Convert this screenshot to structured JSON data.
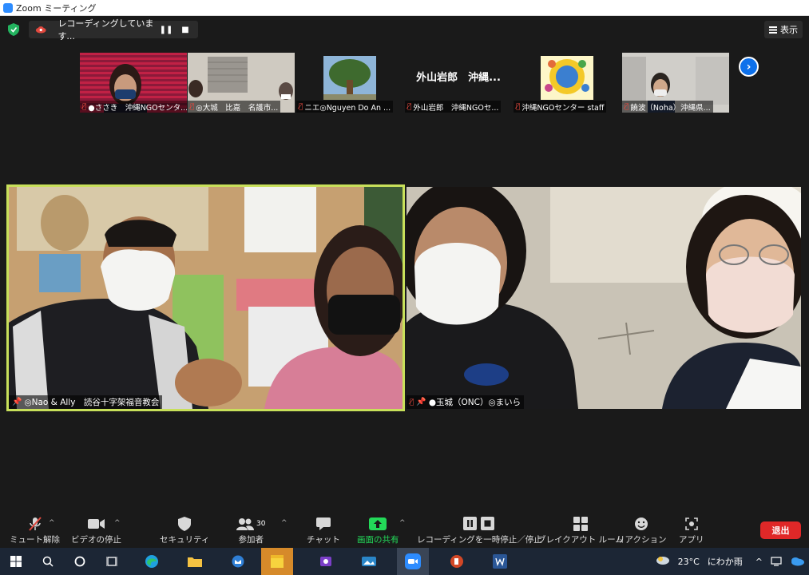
{
  "window": {
    "title": "Zoom ミーティング"
  },
  "recording": {
    "text": "レコーディングしています..."
  },
  "view_button": {
    "label": "表示"
  },
  "thumbnails": [
    {
      "name": "●ささき　沖縄NGOセンタ..."
    },
    {
      "name": "◎大城　比嘉　名護市..."
    },
    {
      "name": "ニエ◎Nguyen Do An ..."
    },
    {
      "name": "外山岩郎　沖縄NGOセ...",
      "display_text": "外山岩郎　沖縄..."
    },
    {
      "name": "沖縄NGOセンター staff"
    },
    {
      "name": "饒波（Noha）沖縄県..."
    }
  ],
  "main_tiles": [
    {
      "name": "◎Nao & Ally　読谷十字架福音教会"
    },
    {
      "name": "●玉城（ONC）◎まいら"
    }
  ],
  "toolbar": {
    "mute": "ミュート解除",
    "video": "ビデオの停止",
    "security": "セキュリティ",
    "participants": "参加者",
    "participants_count": "30",
    "chat": "チャット",
    "share": "画面の共有",
    "record": "レコーディングを一時停止／停止",
    "breakout": "ブレイクアウト ルーム",
    "reactions": "リアクション",
    "apps": "アプリ",
    "leave": "退出"
  },
  "taskbar": {
    "weather": "23°C",
    "weather_desc": "にわか雨"
  },
  "colors": {
    "active_speaker_border": "#c8e05a",
    "share_green": "#23d959",
    "leave_red": "#e02828",
    "accent_blue": "#0e71eb"
  }
}
